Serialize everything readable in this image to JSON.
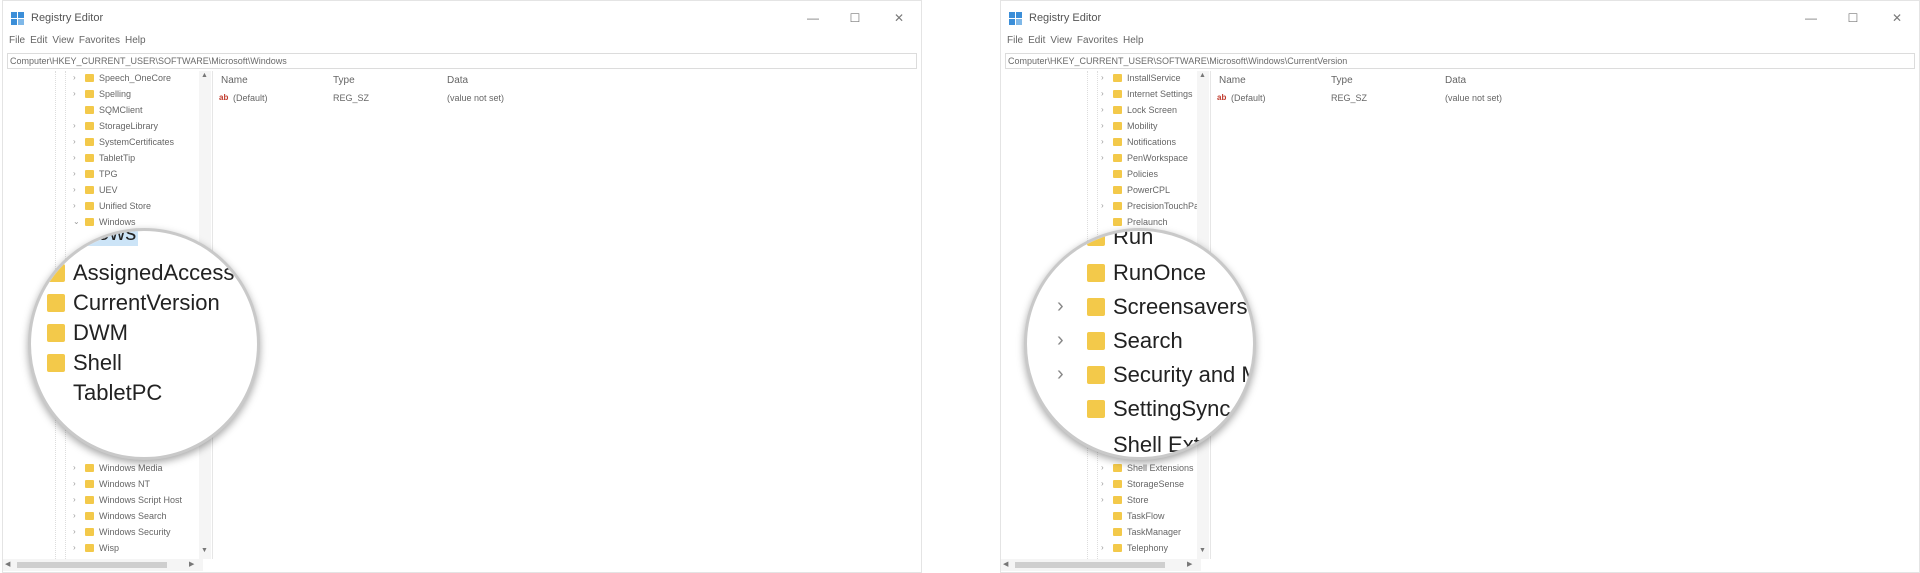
{
  "left": {
    "title": "Registry Editor",
    "menu": [
      "File",
      "Edit",
      "View",
      "Favorites",
      "Help"
    ],
    "address": "Computer\\HKEY_CURRENT_USER\\SOFTWARE\\Microsoft\\Windows",
    "tree_items": [
      "Speech_OneCore",
      "Spelling",
      "SQMClient",
      "StorageLibrary",
      "SystemCertificates",
      "TabletTip",
      "TPG",
      "UEV",
      "Unified Store",
      "Windows",
      "Windows Media",
      "Windows NT",
      "Windows Script Host",
      "Windows Search",
      "Windows Security",
      "Wisp"
    ],
    "magnified": [
      "Windows",
      "AssignedAccess",
      "CurrentVersion",
      "DWM",
      "Shell",
      "TabletPC"
    ],
    "columns": [
      "Name",
      "Type",
      "Data"
    ],
    "row": {
      "name": "(Default)",
      "type": "REG_SZ",
      "data": "(value not set)"
    }
  },
  "right": {
    "title": "Registry Editor",
    "menu": [
      "File",
      "Edit",
      "View",
      "Favorites",
      "Help"
    ],
    "address": "Computer\\HKEY_CURRENT_USER\\SOFTWARE\\Microsoft\\Windows\\CurrentVersion",
    "tree_items": [
      "InstallService",
      "Internet Settings",
      "Lock Screen",
      "Mobility",
      "Notifications",
      "PenWorkspace",
      "Policies",
      "PowerCPL",
      "PrecisionTouchPad",
      "Prelaunch",
      "Shell Extensions",
      "StorageSense",
      "Store",
      "TaskFlow",
      "TaskManager",
      "Telephony"
    ],
    "magnified": [
      "Run",
      "RunOnce",
      "Screensavers",
      "Search",
      "Security and Maintenance",
      "SettingSync",
      "Shell Extensions"
    ],
    "columns": [
      "Name",
      "Type",
      "Data"
    ],
    "row": {
      "name": "(Default)",
      "type": "REG_SZ",
      "data": "(value not set)"
    }
  },
  "icons": {
    "folder": "folder-icon",
    "chevron": "chevron-right-icon",
    "string_value": "string-value-icon",
    "app": "registry-app-icon"
  },
  "window_controls": {
    "minimize": "—",
    "maximize": "☐",
    "close": "✕"
  },
  "colors": {
    "folder": "#f3c94a",
    "selection": "#cce4f7",
    "app_icon": "#3b8ed8"
  }
}
